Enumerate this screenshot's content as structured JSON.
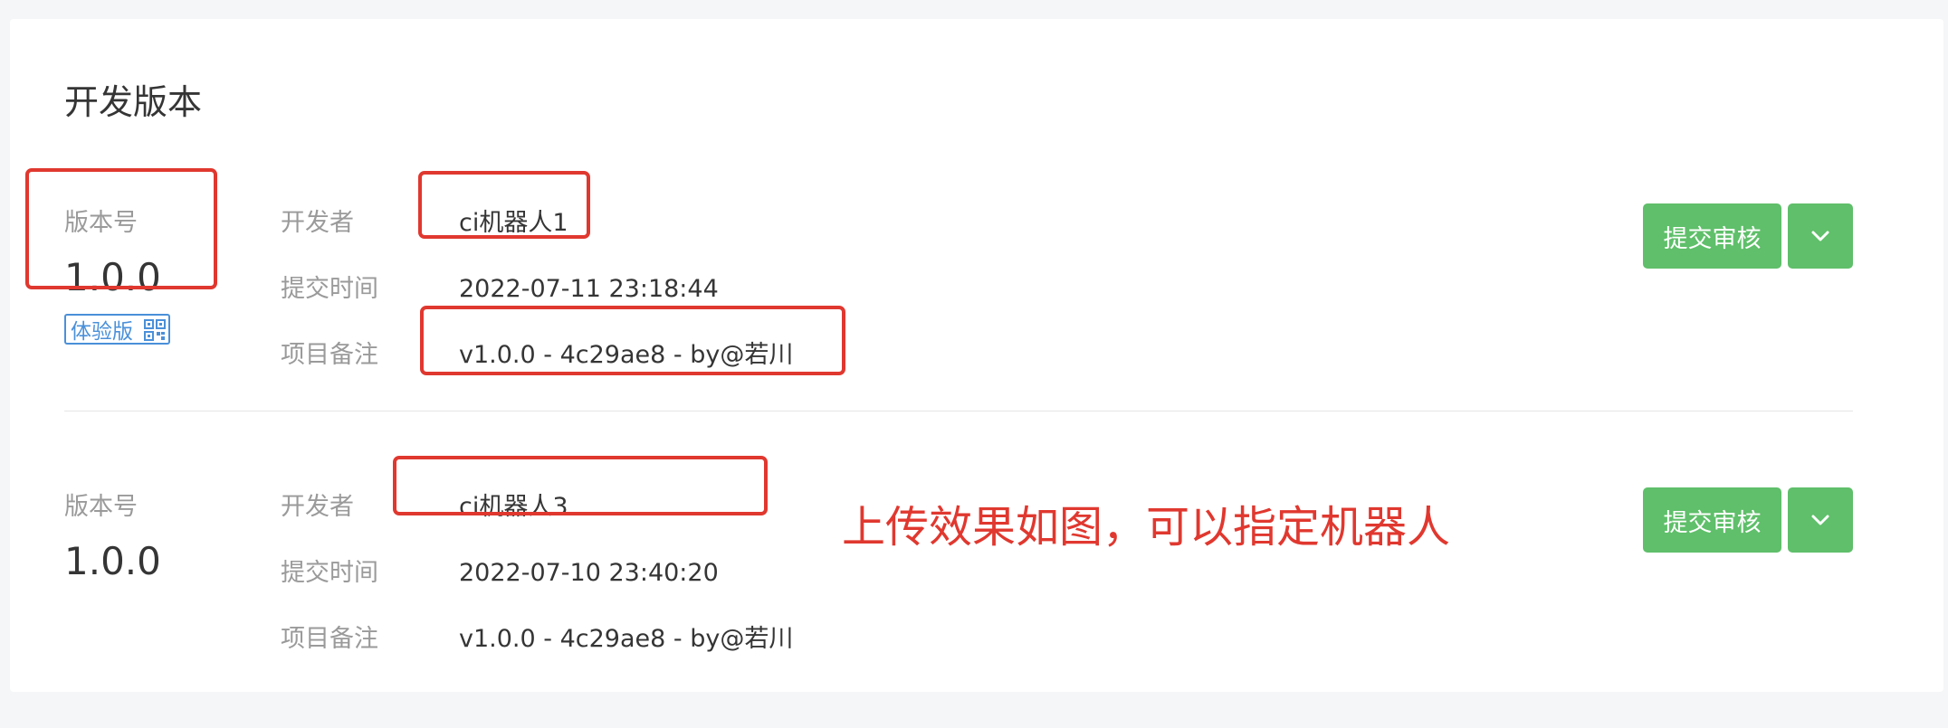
{
  "page_title": "开发版本",
  "versions": [
    {
      "version_label": "版本号",
      "version": "1.0.0",
      "badge": "体验版",
      "fields": [
        {
          "label": "开发者",
          "value": "ci机器人1"
        },
        {
          "label": "提交时间",
          "value": "2022-07-11 23:18:44"
        },
        {
          "label": "项目备注",
          "value": "v1.0.0 - 4c29ae8 - by@若川"
        }
      ],
      "submit_label": "提交审核"
    },
    {
      "version_label": "版本号",
      "version": "1.0.0",
      "fields": [
        {
          "label": "开发者",
          "value": "ci机器人3"
        },
        {
          "label": "提交时间",
          "value": "2022-07-10 23:40:20"
        },
        {
          "label": "项目备注",
          "value": "v1.0.0 - 4c29ae8 - by@若川"
        }
      ],
      "submit_label": "提交审核"
    }
  ],
  "annotation_text": "上传效果如图，可以指定机器人",
  "icons": {
    "qr": "qr-code-icon",
    "dropdown": "chevron-down-icon"
  },
  "colors": {
    "accent_green": "#5fbf6a",
    "annotation_red": "#e0382f",
    "badge_blue": "#4a90d9"
  }
}
